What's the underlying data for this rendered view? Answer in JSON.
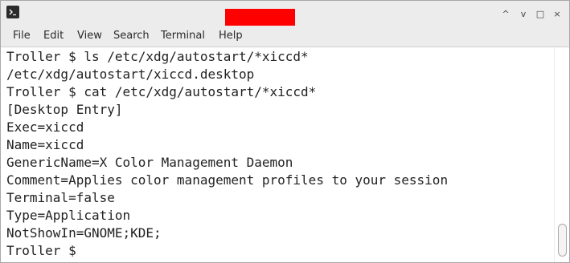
{
  "window": {
    "icon": "terminal-icon",
    "title_redacted": true,
    "controls": [
      {
        "name": "minimize",
        "glyph": "^"
      },
      {
        "name": "restore",
        "glyph": "v"
      },
      {
        "name": "maximize",
        "glyph": "□"
      },
      {
        "name": "close",
        "glyph": "×"
      }
    ]
  },
  "menu": [
    "File",
    "Edit",
    "View",
    "Search",
    "Terminal",
    "Help"
  ],
  "terminal": {
    "lines": [
      "Troller $ ls /etc/xdg/autostart/*xiccd*",
      "/etc/xdg/autostart/xiccd.desktop",
      "Troller $ cat /etc/xdg/autostart/*xiccd*",
      "[Desktop Entry]",
      "Exec=xiccd",
      "Name=xiccd",
      "GenericName=X Color Management Daemon",
      "Comment=Applies color management profiles to your session",
      "Terminal=false",
      "Type=Application",
      "NotShowIn=GNOME;KDE;",
      "Troller $ "
    ]
  },
  "colors": {
    "title_redaction": "#ff0000",
    "terminal_bg": "#ffffff",
    "terminal_fg": "#222222"
  }
}
